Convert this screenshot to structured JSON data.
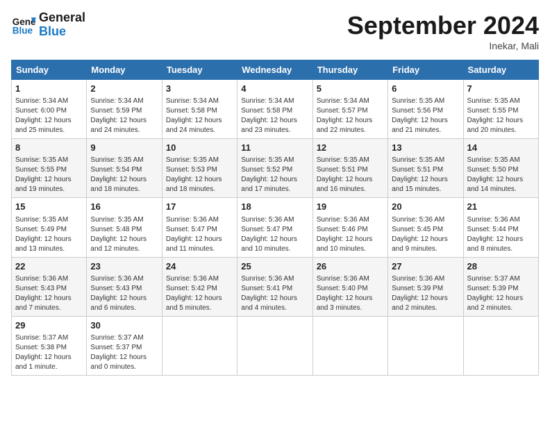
{
  "header": {
    "logo_line1": "General",
    "logo_line2": "Blue",
    "month_title": "September 2024",
    "location": "Inekar, Mali"
  },
  "weekdays": [
    "Sunday",
    "Monday",
    "Tuesday",
    "Wednesday",
    "Thursday",
    "Friday",
    "Saturday"
  ],
  "weeks": [
    [
      {
        "day": "1",
        "info": "Sunrise: 5:34 AM\nSunset: 6:00 PM\nDaylight: 12 hours\nand 25 minutes."
      },
      {
        "day": "2",
        "info": "Sunrise: 5:34 AM\nSunset: 5:59 PM\nDaylight: 12 hours\nand 24 minutes."
      },
      {
        "day": "3",
        "info": "Sunrise: 5:34 AM\nSunset: 5:58 PM\nDaylight: 12 hours\nand 24 minutes."
      },
      {
        "day": "4",
        "info": "Sunrise: 5:34 AM\nSunset: 5:58 PM\nDaylight: 12 hours\nand 23 minutes."
      },
      {
        "day": "5",
        "info": "Sunrise: 5:34 AM\nSunset: 5:57 PM\nDaylight: 12 hours\nand 22 minutes."
      },
      {
        "day": "6",
        "info": "Sunrise: 5:35 AM\nSunset: 5:56 PM\nDaylight: 12 hours\nand 21 minutes."
      },
      {
        "day": "7",
        "info": "Sunrise: 5:35 AM\nSunset: 5:55 PM\nDaylight: 12 hours\nand 20 minutes."
      }
    ],
    [
      {
        "day": "8",
        "info": "Sunrise: 5:35 AM\nSunset: 5:55 PM\nDaylight: 12 hours\nand 19 minutes."
      },
      {
        "day": "9",
        "info": "Sunrise: 5:35 AM\nSunset: 5:54 PM\nDaylight: 12 hours\nand 18 minutes."
      },
      {
        "day": "10",
        "info": "Sunrise: 5:35 AM\nSunset: 5:53 PM\nDaylight: 12 hours\nand 18 minutes."
      },
      {
        "day": "11",
        "info": "Sunrise: 5:35 AM\nSunset: 5:52 PM\nDaylight: 12 hours\nand 17 minutes."
      },
      {
        "day": "12",
        "info": "Sunrise: 5:35 AM\nSunset: 5:51 PM\nDaylight: 12 hours\nand 16 minutes."
      },
      {
        "day": "13",
        "info": "Sunrise: 5:35 AM\nSunset: 5:51 PM\nDaylight: 12 hours\nand 15 minutes."
      },
      {
        "day": "14",
        "info": "Sunrise: 5:35 AM\nSunset: 5:50 PM\nDaylight: 12 hours\nand 14 minutes."
      }
    ],
    [
      {
        "day": "15",
        "info": "Sunrise: 5:35 AM\nSunset: 5:49 PM\nDaylight: 12 hours\nand 13 minutes."
      },
      {
        "day": "16",
        "info": "Sunrise: 5:35 AM\nSunset: 5:48 PM\nDaylight: 12 hours\nand 12 minutes."
      },
      {
        "day": "17",
        "info": "Sunrise: 5:36 AM\nSunset: 5:47 PM\nDaylight: 12 hours\nand 11 minutes."
      },
      {
        "day": "18",
        "info": "Sunrise: 5:36 AM\nSunset: 5:47 PM\nDaylight: 12 hours\nand 10 minutes."
      },
      {
        "day": "19",
        "info": "Sunrise: 5:36 AM\nSunset: 5:46 PM\nDaylight: 12 hours\nand 10 minutes."
      },
      {
        "day": "20",
        "info": "Sunrise: 5:36 AM\nSunset: 5:45 PM\nDaylight: 12 hours\nand 9 minutes."
      },
      {
        "day": "21",
        "info": "Sunrise: 5:36 AM\nSunset: 5:44 PM\nDaylight: 12 hours\nand 8 minutes."
      }
    ],
    [
      {
        "day": "22",
        "info": "Sunrise: 5:36 AM\nSunset: 5:43 PM\nDaylight: 12 hours\nand 7 minutes."
      },
      {
        "day": "23",
        "info": "Sunrise: 5:36 AM\nSunset: 5:43 PM\nDaylight: 12 hours\nand 6 minutes."
      },
      {
        "day": "24",
        "info": "Sunrise: 5:36 AM\nSunset: 5:42 PM\nDaylight: 12 hours\nand 5 minutes."
      },
      {
        "day": "25",
        "info": "Sunrise: 5:36 AM\nSunset: 5:41 PM\nDaylight: 12 hours\nand 4 minutes."
      },
      {
        "day": "26",
        "info": "Sunrise: 5:36 AM\nSunset: 5:40 PM\nDaylight: 12 hours\nand 3 minutes."
      },
      {
        "day": "27",
        "info": "Sunrise: 5:36 AM\nSunset: 5:39 PM\nDaylight: 12 hours\nand 2 minutes."
      },
      {
        "day": "28",
        "info": "Sunrise: 5:37 AM\nSunset: 5:39 PM\nDaylight: 12 hours\nand 2 minutes."
      }
    ],
    [
      {
        "day": "29",
        "info": "Sunrise: 5:37 AM\nSunset: 5:38 PM\nDaylight: 12 hours\nand 1 minute."
      },
      {
        "day": "30",
        "info": "Sunrise: 5:37 AM\nSunset: 5:37 PM\nDaylight: 12 hours\nand 0 minutes."
      },
      null,
      null,
      null,
      null,
      null
    ]
  ]
}
